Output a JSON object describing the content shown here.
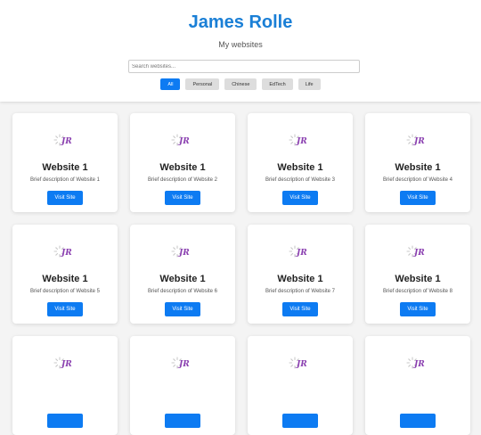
{
  "header": {
    "title": "James Rolle",
    "subtitle": "My websites",
    "search_placeholder": "Search websites..."
  },
  "filters": [
    {
      "label": "All",
      "active": true
    },
    {
      "label": "Personal",
      "active": false
    },
    {
      "label": "Chinese",
      "active": false
    },
    {
      "label": "EdTech",
      "active": false
    },
    {
      "label": "Life",
      "active": false
    }
  ],
  "logo": {
    "text": "JR",
    "icon": "spinner-logo-icon",
    "color": "#8a3fb0"
  },
  "colors": {
    "accent": "#0d7bf2",
    "title": "#1a7fd6"
  },
  "cards": [
    {
      "title": "Website 1",
      "description": "Brief description of Website 1",
      "button": "Visit Site"
    },
    {
      "title": "Website 1",
      "description": "Brief description of Website 2",
      "button": "Visit Site"
    },
    {
      "title": "Website 1",
      "description": "Brief description of Website 3",
      "button": "Visit Site"
    },
    {
      "title": "Website 1",
      "description": "Brief description of Website 4",
      "button": "Visit Site"
    },
    {
      "title": "Website 1",
      "description": "Brief description of Website 5",
      "button": "Visit Site"
    },
    {
      "title": "Website 1",
      "description": "Brief description of Website 6",
      "button": "Visit Site"
    },
    {
      "title": "Website 1",
      "description": "Brief description of Website 7",
      "button": "Visit Site"
    },
    {
      "title": "Website 1",
      "description": "Brief description of Website 8",
      "button": "Visit Site"
    },
    {
      "title": "",
      "description": "",
      "button": ""
    },
    {
      "title": "",
      "description": "",
      "button": ""
    },
    {
      "title": "",
      "description": "",
      "button": ""
    },
    {
      "title": "",
      "description": "",
      "button": ""
    }
  ]
}
